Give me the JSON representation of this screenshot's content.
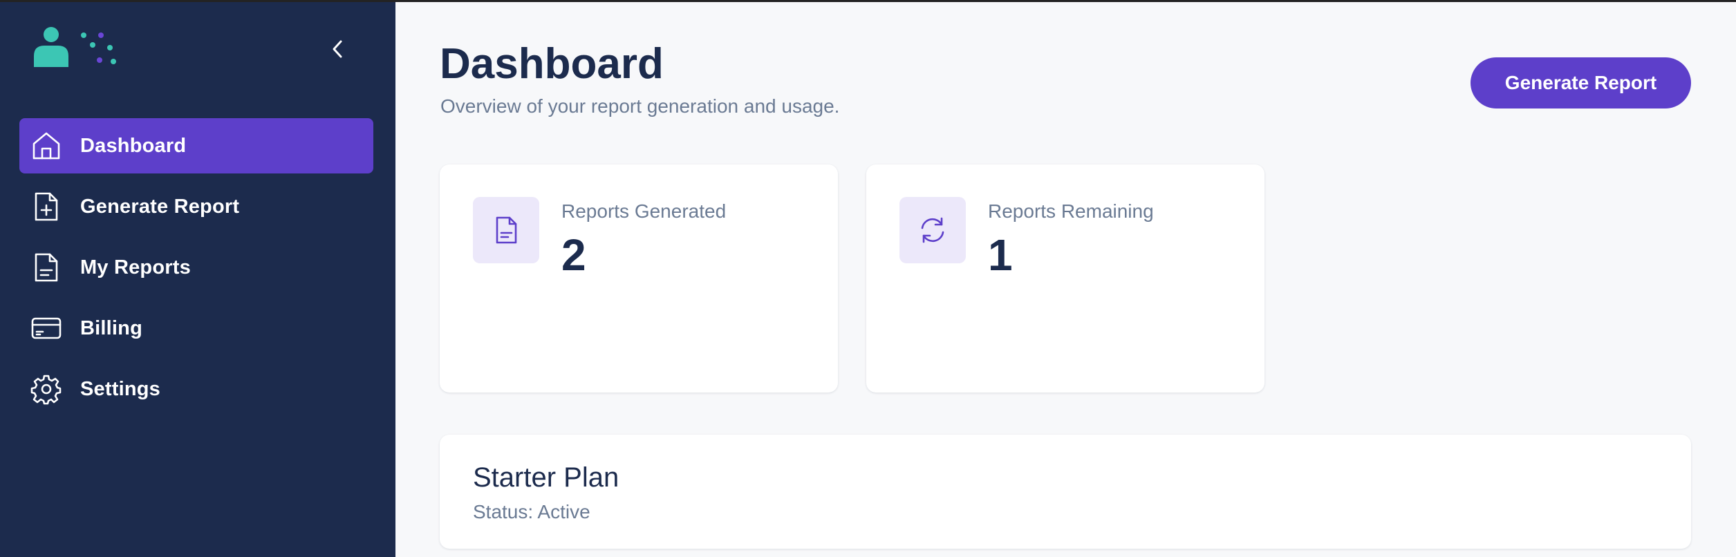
{
  "sidebar": {
    "items": [
      {
        "label": "Dashboard",
        "icon": "home-icon",
        "active": true
      },
      {
        "label": "Generate Report",
        "icon": "file-plus-icon",
        "active": false
      },
      {
        "label": "My Reports",
        "icon": "file-text-icon",
        "active": false
      },
      {
        "label": "Billing",
        "icon": "credit-card-icon",
        "active": false
      },
      {
        "label": "Settings",
        "icon": "gear-icon",
        "active": false
      }
    ]
  },
  "header": {
    "title": "Dashboard",
    "subtitle": "Overview of your report generation and usage.",
    "primary_button": "Generate Report"
  },
  "stats": [
    {
      "label": "Reports Generated",
      "value": "2",
      "icon": "document-icon"
    },
    {
      "label": "Reports Remaining",
      "value": "1",
      "icon": "refresh-icon"
    }
  ],
  "plan": {
    "name": "Starter Plan",
    "status": "Status: Active"
  },
  "colors": {
    "sidebar_bg": "#1c2b4d",
    "accent": "#5d3fca",
    "logo_teal": "#3cc6b4",
    "logo_purple": "#6a46d6"
  }
}
